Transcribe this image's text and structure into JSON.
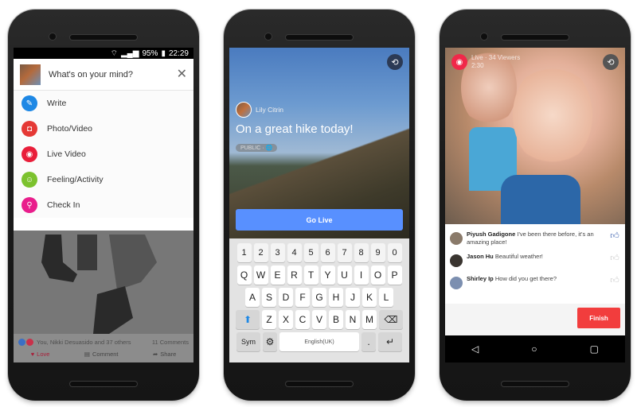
{
  "phone1": {
    "status": {
      "battery": "95%",
      "time": "22:29"
    },
    "composer": {
      "prompt": "What's on your mind?",
      "close_icon": "close-icon"
    },
    "menu": [
      {
        "label": "Write",
        "icon": "pencil-icon",
        "color": "#1e88e5"
      },
      {
        "label": "Photo/Video",
        "icon": "camera-icon",
        "color": "#e53935"
      },
      {
        "label": "Live Video",
        "icon": "live-icon",
        "color": "#e91e3a"
      },
      {
        "label": "Feeling/Activity",
        "icon": "smiley-icon",
        "color": "#7cc22e"
      },
      {
        "label": "Check In",
        "icon": "location-pin-icon",
        "color": "#e91e8c"
      }
    ],
    "post": {
      "reactions_text": "You, Nikki Desuasido and 37 others",
      "comments_count": "11 Comments",
      "actions": [
        "Love",
        "Comment",
        "Share"
      ]
    }
  },
  "phone2": {
    "author": "Lily Citrin",
    "post_text": "On a great hike today!",
    "privacy": "PUBLIC · 🌐",
    "go_live": "Go Live",
    "keyboard": {
      "row_numbers": [
        "1",
        "2",
        "3",
        "4",
        "5",
        "6",
        "7",
        "8",
        "9",
        "0"
      ],
      "row1": [
        "Q",
        "W",
        "E",
        "R",
        "T",
        "Y",
        "U",
        "I",
        "O",
        "P"
      ],
      "row2": [
        "A",
        "S",
        "D",
        "F",
        "G",
        "H",
        "J",
        "K",
        "L"
      ],
      "row3": [
        "Z",
        "X",
        "C",
        "V",
        "B",
        "N",
        "M"
      ],
      "sym": "Sym",
      "space": "English(UK)",
      "period": "."
    }
  },
  "phone3": {
    "live": {
      "label": "Live · 34 Viewers",
      "duration": "2:30"
    },
    "comments": [
      {
        "name": "Piyush Gadigone",
        "text": "I've been there before, it's an amazing place!",
        "liked": true,
        "avatar_color": "#8a7a6a"
      },
      {
        "name": "Jason Hu",
        "text": "Beautiful weather!",
        "liked": false,
        "avatar_color": "#3a3530"
      },
      {
        "name": "Shirley Ip",
        "text": "How did you get there?",
        "liked": false,
        "avatar_color": "#7c8fb0"
      }
    ],
    "finish": "Finish"
  }
}
